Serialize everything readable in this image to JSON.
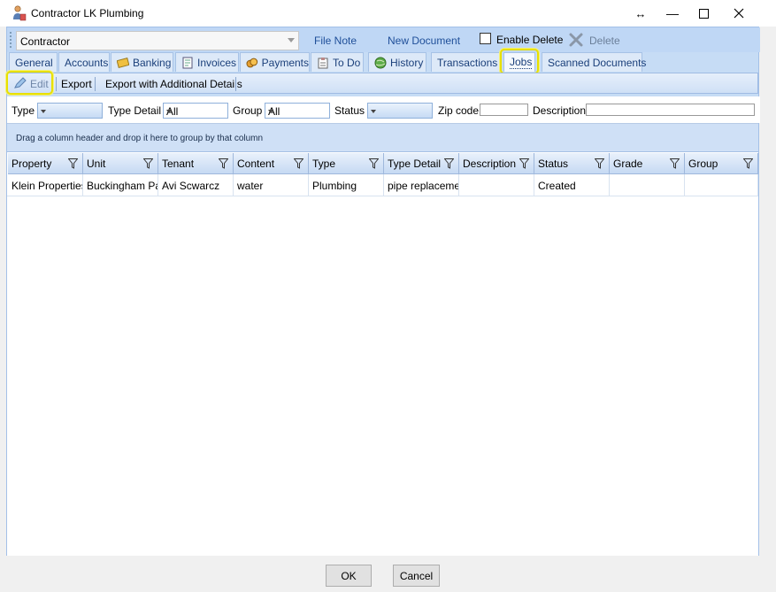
{
  "window": {
    "title": "Contractor LK Plumbing",
    "controls": {
      "resize": "↔",
      "minimize": "—",
      "maximize": "☐",
      "close": "✕"
    }
  },
  "toolbar": {
    "contractor_value": "Contractor",
    "file_note": "File Note",
    "new_document": "New Document",
    "enable_delete": "Enable Delete",
    "enable_delete_checked": false,
    "delete": "Delete"
  },
  "tabs": [
    {
      "label": "General",
      "icon": ""
    },
    {
      "label": "Accounts",
      "icon": ""
    },
    {
      "label": "Banking",
      "icon": "banking-card-icon"
    },
    {
      "label": "Invoices",
      "icon": "invoice-icon"
    },
    {
      "label": "Payments",
      "icon": "coins-icon"
    },
    {
      "label": "To Do",
      "icon": "todo-clipboard-icon"
    },
    {
      "label": "History",
      "icon": "history-globe-icon"
    },
    {
      "label": "Transactions",
      "icon": ""
    },
    {
      "label": "Jobs",
      "icon": "",
      "active": true
    },
    {
      "label": "Scanned Documents",
      "icon": ""
    }
  ],
  "subtoolbar": {
    "edit": "Edit",
    "export": "Export",
    "export_details": "Export with Additional Details"
  },
  "filters": {
    "type_label": "Type",
    "type_value": "",
    "type_detail_label": "Type Detail",
    "type_detail_value": "All",
    "group_label": "Group",
    "group_value": "All",
    "status_label": "Status",
    "status_value": "",
    "zip_label": "Zip code",
    "zip_value": "",
    "description_label": "Description",
    "description_value": ""
  },
  "grid": {
    "group_hint": "Drag a column header and drop it here to group by that column",
    "columns": [
      "Property",
      "Unit",
      "Tenant",
      "Content",
      "Type",
      "Type Detail",
      "Description",
      "Status",
      "Grade",
      "Group"
    ],
    "rows": [
      [
        "Klein Properties",
        "Buckingham Pa",
        "Avi Scwarcz",
        "water",
        "Plumbing",
        "pipe replacemen",
        "",
        "Created",
        "",
        ""
      ]
    ]
  },
  "buttons": {
    "ok": "OK",
    "cancel": "Cancel"
  },
  "colors": {
    "highlight": "#e8e000",
    "tab_text": "#1a3f7a",
    "panel_blue": "#c6dcf5"
  }
}
